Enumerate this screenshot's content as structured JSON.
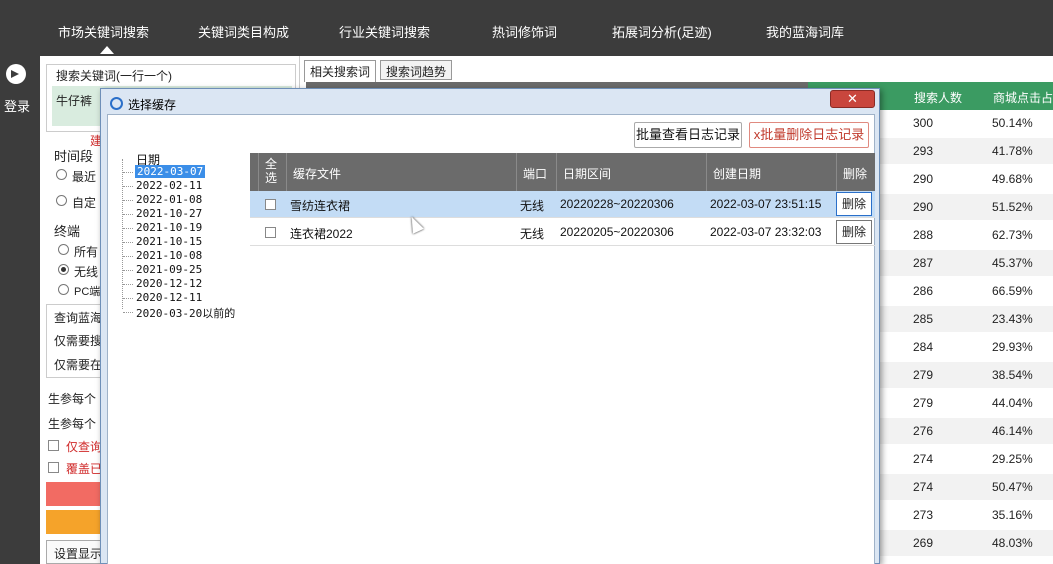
{
  "nav": {
    "items": [
      "市场关键词搜索",
      "关键词类目构成",
      "行业关键词搜索",
      "热词修饰词",
      "拓展词分析(足迹)",
      "我的蓝海词库"
    ]
  },
  "sidebar": {
    "login_label": "登录"
  },
  "left_panel": {
    "keyword_label": "搜索关键词(一行一个)",
    "keyword_value": "牛仔裤",
    "red_mark": "建",
    "time_label": "时间段",
    "time_opt1": "最近",
    "time_opt2": "自定",
    "terminal_label": "终端",
    "term_opt1": "所有",
    "term_opt2": "无线",
    "term_opt3": "PC端",
    "blue_ocean_label": "查询蓝海",
    "only_need1": "仅需要搜",
    "only_need2": "仅需要在",
    "gen1": "生参每个",
    "gen2": "生参每个",
    "check1": "仅查询",
    "check2": "覆盖已",
    "settings_btn": "设置显示"
  },
  "right": {
    "tabs": [
      "相关搜索词",
      "搜索词趋势"
    ],
    "header_cols": [
      "搜索人数",
      "商城点击占"
    ],
    "rows": [
      [
        "300",
        "50.14%"
      ],
      [
        "293",
        "41.78%"
      ],
      [
        "290",
        "49.68%"
      ],
      [
        "290",
        "51.52%"
      ],
      [
        "288",
        "62.73%"
      ],
      [
        "287",
        "45.37%"
      ],
      [
        "286",
        "66.59%"
      ],
      [
        "285",
        "23.43%"
      ],
      [
        "284",
        "29.93%"
      ],
      [
        "279",
        "38.54%"
      ],
      [
        "279",
        "44.04%"
      ],
      [
        "276",
        "46.14%"
      ],
      [
        "274",
        "29.25%"
      ],
      [
        "274",
        "50.47%"
      ],
      [
        "273",
        "35.16%"
      ],
      [
        "269",
        "48.03%"
      ]
    ]
  },
  "dialog": {
    "title": "选择缓存",
    "close_label": "✕",
    "btn_view_logs": "批量查看日志记录",
    "btn_delete_logs": "x批量删除日志记录",
    "tree_root": "日期",
    "tree_dates": [
      "2022-03-07",
      "2022-02-11",
      "2022-01-08",
      "2021-10-27",
      "2021-10-19",
      "2021-10-15",
      "2021-10-08",
      "2021-09-25",
      "2020-12-12",
      "2020-12-11",
      "2020-03-20以前的"
    ],
    "grid_headers": [
      "全选",
      "缓存文件",
      "端口",
      "日期区间",
      "创建日期",
      "删除"
    ],
    "grid_rows": [
      {
        "file": "雪纺连衣裙",
        "port": "无线",
        "range": "20220228~20220306",
        "created": "2022-03-07 23:51:15",
        "delete": "删除"
      },
      {
        "file": "连衣裙2022",
        "port": "无线",
        "range": "20220205~20220306",
        "created": "2022-03-07 23:32:03",
        "delete": "删除"
      }
    ]
  },
  "colors": {
    "accent_green": "#3b9b62",
    "selection_blue": "#3b8ee8",
    "danger_red": "#c0392b"
  }
}
